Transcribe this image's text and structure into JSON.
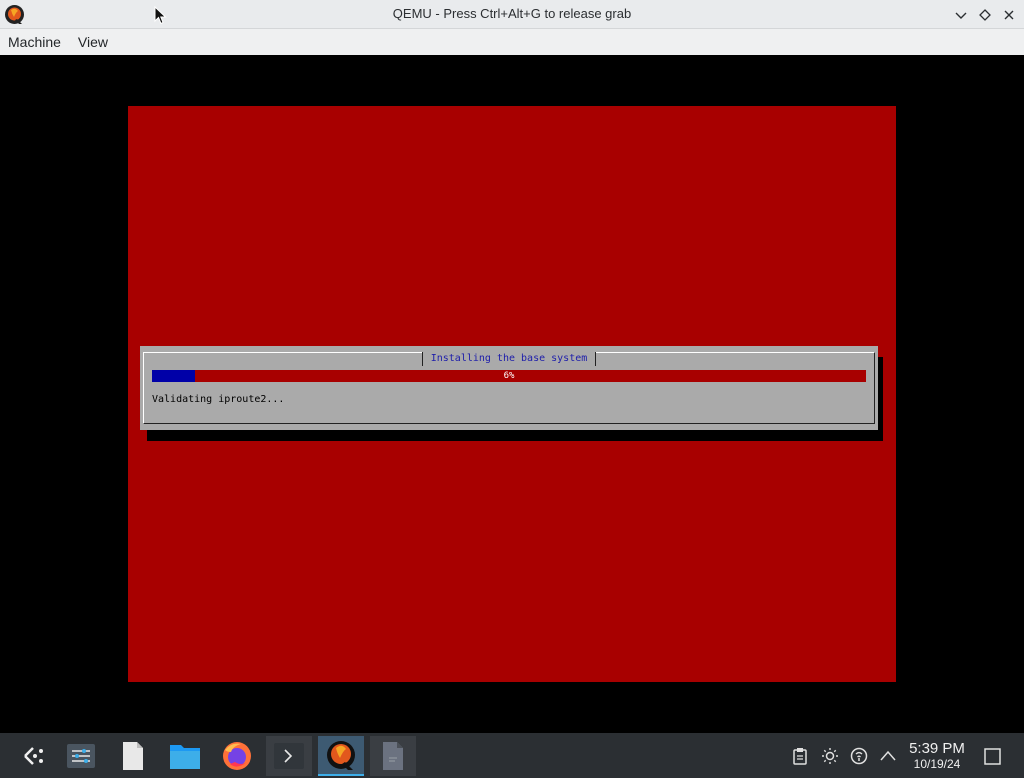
{
  "window": {
    "title": "QEMU - Press Ctrl+Alt+G to release grab"
  },
  "menu": {
    "items": [
      "Machine",
      "View"
    ]
  },
  "installer": {
    "dialog_title": "Installing the base system",
    "progress_percent": 6,
    "progress_label": "6%",
    "status_text": "Validating iproute2..."
  },
  "colors": {
    "installer_background": "#a80000",
    "dialog": "#aaaaaa",
    "progress_fill": "#0000a8",
    "dialog_title": "#1e1eaa",
    "taskbar": "#2b2f33",
    "active_task": "#3d5a72"
  },
  "taskbar": {
    "apps": [
      {
        "name": "application-launcher",
        "icon": "launcher-icon"
      },
      {
        "name": "task-manager",
        "icon": "sliders-icon"
      },
      {
        "name": "text-editor",
        "icon": "document-icon"
      },
      {
        "name": "file-manager",
        "icon": "folder-icon"
      },
      {
        "name": "firefox",
        "icon": "firefox-icon"
      },
      {
        "name": "terminal",
        "icon": "terminal-icon"
      },
      {
        "name": "qemu",
        "icon": "qemu-icon",
        "active": true
      },
      {
        "name": "document-viewer",
        "icon": "document-viewer-icon"
      }
    ],
    "tray": [
      "clipboard-icon",
      "brightness-icon",
      "network-icon",
      "expand-tray-icon"
    ],
    "clock_time": "5:39 PM",
    "clock_date": "10/19/24"
  }
}
